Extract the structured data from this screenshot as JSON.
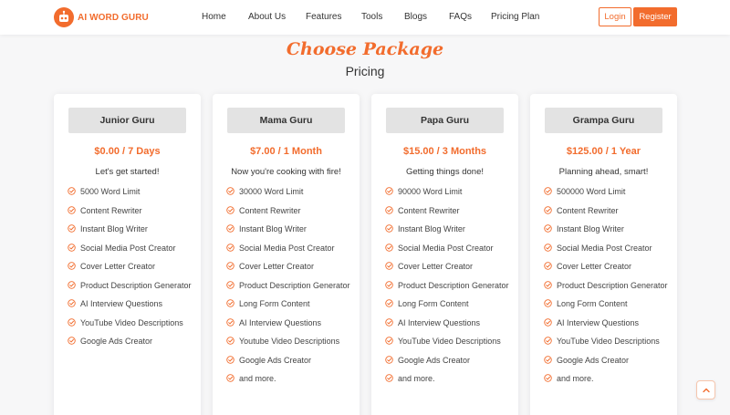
{
  "brand": {
    "name": "AI WORD GURU",
    "icon": "robot-icon",
    "accent": "#f26c2d"
  },
  "nav": [
    "Home",
    "About Us",
    "Features",
    "Tools",
    "Blogs",
    "FAQs",
    "Pricing Plan"
  ],
  "auth": {
    "login": "Login",
    "register": "Register"
  },
  "section": {
    "title": "Choose Package",
    "subtitle": "Pricing"
  },
  "plans": [
    {
      "name": "Junior Guru",
      "price": "$0.00 / 7 Days",
      "tagline": "Let's get started!",
      "features": [
        "5000 Word Limit",
        "Content Rewriter",
        "Instant Blog Writer",
        "Social Media Post Creator",
        "Cover Letter Creator",
        "Product Description Generator",
        "AI Interview Questions",
        "YouTube Video Descriptions",
        "Google Ads Creator"
      ]
    },
    {
      "name": "Mama Guru",
      "price": "$7.00 / 1 Month",
      "tagline": "Now you're cooking with fire!",
      "features": [
        "30000 Word Limit",
        "Content Rewriter",
        "Instant Blog Writer",
        "Social Media Post Creator",
        "Cover Letter Creator",
        "Product Description Generator",
        "Long Form Content",
        "AI Interview Questions",
        "Youtube Video Descriptions",
        "Google Ads Creator",
        "and more."
      ]
    },
    {
      "name": "Papa Guru",
      "price": "$15.00 / 3 Months",
      "tagline": "Getting things done!",
      "features": [
        "90000 Word Limit",
        "Content Rewriter",
        "Instant Blog Writer",
        "Social Media Post Creator",
        "Cover Letter Creator",
        "Product Description Generator",
        "Long Form Content",
        "AI Interview Questions",
        "YouTube Video Descriptions",
        "Google Ads Creator",
        "and more."
      ]
    },
    {
      "name": "Grampa Guru",
      "price": "$125.00 / 1 Year",
      "tagline": "Planning ahead, smart!",
      "features": [
        "500000 Word Limit",
        "Content Rewriter",
        "Instant Blog Writer",
        "Social Media Post Creator",
        "Cover Letter Creator",
        "Product Description Generator",
        "Long Form Content",
        "AI Interview Questions",
        "YouTube Video Descriptions",
        "Google Ads Creator",
        "and more."
      ]
    }
  ],
  "icons": {
    "feature": "check-circle-icon",
    "scroll_top": "chevron-up-icon"
  }
}
